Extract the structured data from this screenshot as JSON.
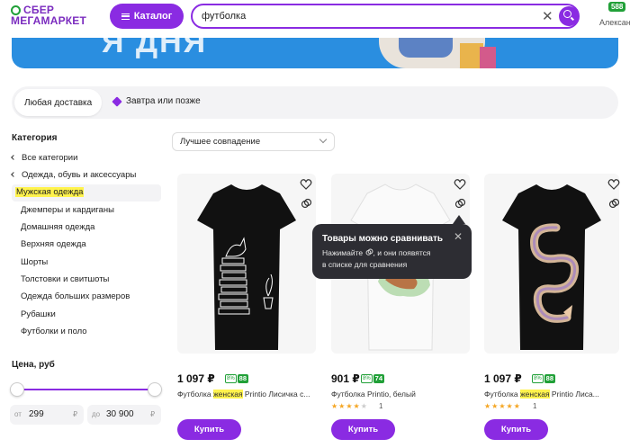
{
  "header": {
    "logo_line1": "СБЕР",
    "logo_line2": "МЕГАМАРКЕТ",
    "catalog_label": "Каталог",
    "search_value": "футболка",
    "bonus_badge": "588",
    "user_name": "Алексан"
  },
  "banner": {
    "text": "Я ДНЯ"
  },
  "delivery": {
    "any_label": "Любая доставка",
    "tomorrow_label": "Завтра или позже"
  },
  "sidebar": {
    "category_title": "Категория",
    "all_categories": "Все категории",
    "parent_category": "Одежда, обувь и аксессуары",
    "active_category": "Мужская одежда",
    "subcategories": [
      "Джемперы и кардиганы",
      "Домашняя одежда",
      "Верхняя одежда",
      "Шорты",
      "Толстовки и свитшоты",
      "Одежда больших размеров",
      "Рубашки",
      "Футболки и поло"
    ],
    "price_title": "Цена, руб",
    "price_from_prefix": "от",
    "price_from": "299",
    "price_to_prefix": "до",
    "price_to": "30 900",
    "currency": "₽"
  },
  "sort": {
    "label": "Лучшее совпадение"
  },
  "products": [
    {
      "price": "1 097 ₽",
      "bonus_pct": "8%",
      "bonus_value": "88",
      "title_pre": "Футболка ",
      "title_hl": "женская",
      "title_post": " Printio Лисичка с...",
      "stars": 0,
      "rating_count": "",
      "buy_label": "Купить"
    },
    {
      "price": "901 ₽",
      "bonus_pct": "8%",
      "bonus_value": "74",
      "title_pre": "Футболка Printio, белый",
      "title_hl": "",
      "title_post": "",
      "stars": 4,
      "rating_count": "1",
      "buy_label": "Купить"
    },
    {
      "price": "1 097 ₽",
      "bonus_pct": "8%",
      "bonus_value": "88",
      "title_pre": "Футболка ",
      "title_hl": "женская",
      "title_post": " Printio Лиса...",
      "stars": 5,
      "rating_count": "1",
      "buy_label": "Купить"
    }
  ],
  "tooltip": {
    "title": "Товары можно сравнивать",
    "line1_pre": "Нажимайте",
    "line1_post": ", и они появятся",
    "line2": "в списке для сравнения"
  },
  "colors": {
    "accent": "#8a2be2",
    "bonus": "#21a038",
    "highlight": "#fff34d",
    "banner": "#2a8ee0"
  },
  "icons": [
    "search-icon",
    "close-icon",
    "heart-icon",
    "compare-icon",
    "cube-icon",
    "burger-icon"
  ]
}
